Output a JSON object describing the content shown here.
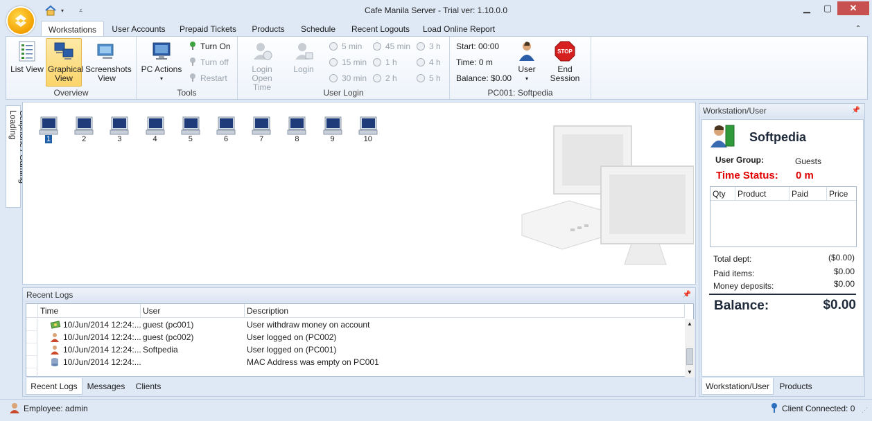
{
  "window": {
    "title": "Cafe Manila Server - Trial ver: 1.10.0.0"
  },
  "tabs": [
    "Workstations",
    "User Accounts",
    "Prepaid Tickets",
    "Products",
    "Schedule",
    "Recent Logouts",
    "Load Online Report"
  ],
  "ribbon": {
    "overview": {
      "label": "Overview",
      "list_view": "List View",
      "graphical_view": "Graphical View",
      "screenshots_view": "Screenshots View"
    },
    "tools": {
      "label": "Tools",
      "pc_actions": "PC Actions",
      "turn_on": "Turn On",
      "turn_off": "Turn off",
      "restart": "Restart"
    },
    "user_login": {
      "label": "User Login",
      "login_open_time": "Login Open Time",
      "login": "Login",
      "times": [
        "5 min",
        "15 min",
        "30 min",
        "45 min",
        "1 h",
        "2 h",
        "3 h",
        "4 h",
        "5 h"
      ]
    },
    "session": {
      "label": "PC001: Softpedia",
      "start": "Start: 00:00",
      "time": "Time: 0 m",
      "balance": "Balance: $0.00",
      "user": "User",
      "end_session": "End Session",
      "stop_text": "STOP"
    }
  },
  "side_tab": "Cellphone / Gaming Loading",
  "workstations": [
    "1",
    "2",
    "3",
    "4",
    "5",
    "6",
    "7",
    "8",
    "9",
    "10"
  ],
  "recent_logs": {
    "title": "Recent Logs",
    "columns": [
      "Time",
      "User",
      "Description"
    ],
    "rows": [
      {
        "time": "10/Jun/2014 12:24:...",
        "user": "guest (pc001)",
        "description": "User withdraw money on account",
        "icon": "money-icon"
      },
      {
        "time": "10/Jun/2014 12:24:...",
        "user": "guest (pc002)",
        "description": "User logged on (PC002)",
        "icon": "user-icon"
      },
      {
        "time": "10/Jun/2014 12:24:...",
        "user": "Softpedia",
        "description": "User logged on (PC001)",
        "icon": "user-icon"
      },
      {
        "time": "10/Jun/2014 12:24:...",
        "user": "",
        "description": "MAC Address was empty on PC001",
        "icon": "database-icon"
      }
    ],
    "tabs": [
      "Recent Logs",
      "Messages",
      "Clients"
    ]
  },
  "workstation_user": {
    "title": "Workstation/User",
    "name": "Softpedia",
    "user_group_label": "User Group:",
    "user_group": "Guests",
    "time_status_label": "Time Status:",
    "time_status": "0 m",
    "product_columns": [
      "Qty",
      "Product",
      "Paid",
      "Price"
    ],
    "total_dept_label": "Total dept:",
    "total_dept": "($0.00)",
    "paid_items_label": "Paid items:",
    "paid_items": "$0.00",
    "money_deposits_label": "Money deposits:",
    "money_deposits": "$0.00",
    "balance_label": "Balance:",
    "balance": "$0.00",
    "tabs": [
      "Workstation/User",
      "Products"
    ]
  },
  "status": {
    "employee": "Employee: admin",
    "clients": "Client Connected: 0"
  },
  "colors": {
    "accent": "#1f5fa8",
    "alert": "#e00000",
    "chrome": "#dfe9f5"
  }
}
